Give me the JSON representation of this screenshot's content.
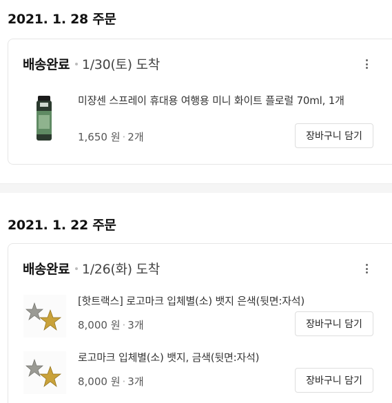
{
  "orders": [
    {
      "date": "2021. 1. 28 주문",
      "status": "배송완료",
      "arrival": "1/30(토) 도착",
      "items": [
        {
          "name": "미쟝센 스프레이 휴대용 여행용 미니 화이트 플로럴 70ml, 1개",
          "price": "1,650 원",
          "qty": "2개",
          "cart_label": "장바구니 담기"
        }
      ]
    },
    {
      "date": "2021. 1. 22 주문",
      "status": "배송완료",
      "arrival": "1/26(화) 도착",
      "items": [
        {
          "name": "[핫트랙스] 로고마크 입체별(소) 뱃지 은색(뒷면:자석)",
          "price": "8,000 원",
          "qty": "3개",
          "cart_label": "장바구니 담기"
        },
        {
          "name": "로고마크 입체별(소) 뱃지, 금색(뒷면:자석)",
          "price": "8,000 원",
          "qty": "3개",
          "cart_label": "장바구니 담기"
        }
      ]
    }
  ]
}
